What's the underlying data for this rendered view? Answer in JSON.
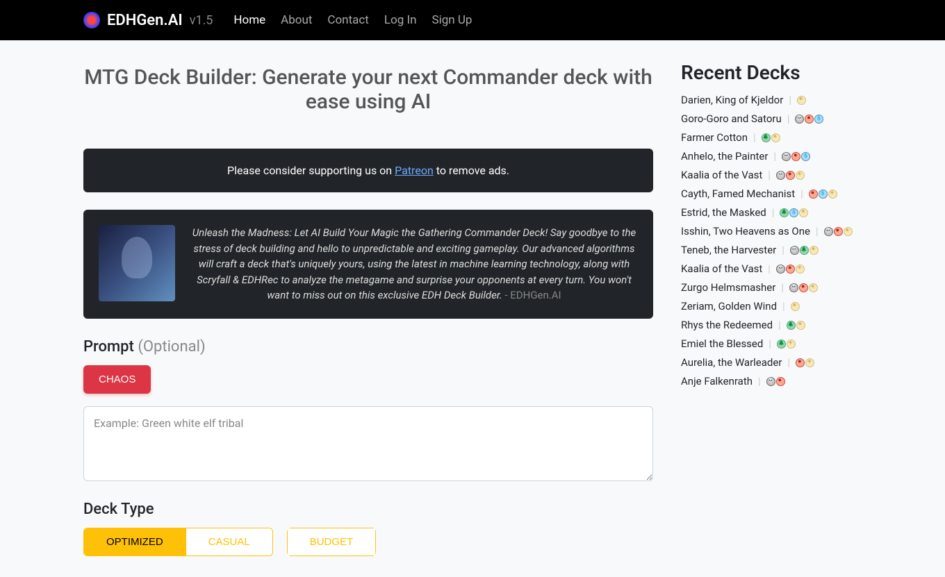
{
  "header": {
    "brand_name": "EDHGen.AI",
    "brand_version": "v1.5",
    "nav": [
      "Home",
      "About",
      "Contact",
      "Log In",
      "Sign Up"
    ],
    "active_nav_index": 0
  },
  "main": {
    "page_title": "MTG Deck Builder: Generate your next Commander deck with ease using AI",
    "support_banner": {
      "prefix": "Please consider supporting us on ",
      "link_text": "Patreon",
      "suffix": " to remove ads."
    },
    "promo": {
      "text": "Unleash the Madness: Let AI Build Your Magic the Gathering Commander Deck! Say goodbye to the stress of deck building and hello to unpredictable and exciting gameplay. Our advanced algorithms will craft a deck that's uniquely yours, using the latest in machine learning technology, along with Scryfall & EDHRec to analyze the metagame and surprise your opponents at every turn. You won't want to miss out on this exclusive EDH Deck Builder.",
      "attribution": " - EDHGen.AI"
    },
    "prompt": {
      "label": "Prompt ",
      "optional": "(Optional)",
      "chaos_button": "CHAOS",
      "placeholder": "Example: Green white elf tribal",
      "value": ""
    },
    "deck_type": {
      "label": "Deck Type",
      "options": [
        "OPTIMIZED",
        "CASUAL",
        "BUDGET"
      ],
      "selected_index": 0
    }
  },
  "sidebar": {
    "heading": "Recent Decks",
    "decks": [
      {
        "name": "Darien, King of Kjeldor",
        "colors": [
          "w"
        ]
      },
      {
        "name": "Goro-Goro and Satoru",
        "colors": [
          "b",
          "r",
          "u"
        ]
      },
      {
        "name": "Farmer Cotton",
        "colors": [
          "g",
          "w"
        ]
      },
      {
        "name": "Anhelo, the Painter",
        "colors": [
          "b",
          "r",
          "u"
        ]
      },
      {
        "name": "Kaalia of the Vast",
        "colors": [
          "b",
          "r",
          "w"
        ]
      },
      {
        "name": "Cayth, Famed Mechanist",
        "colors": [
          "r",
          "u",
          "w"
        ]
      },
      {
        "name": "Estrid, the Masked",
        "colors": [
          "g",
          "u",
          "w"
        ]
      },
      {
        "name": "Isshin, Two Heavens as One",
        "colors": [
          "b",
          "r",
          "w"
        ]
      },
      {
        "name": "Teneb, the Harvester",
        "colors": [
          "b",
          "g",
          "w"
        ]
      },
      {
        "name": "Kaalia of the Vast",
        "colors": [
          "b",
          "r",
          "w"
        ]
      },
      {
        "name": "Zurgo Helmsmasher",
        "colors": [
          "b",
          "r",
          "w"
        ]
      },
      {
        "name": "Zeriam, Golden Wind",
        "colors": [
          "w"
        ]
      },
      {
        "name": "Rhys the Redeemed",
        "colors": [
          "g",
          "w"
        ]
      },
      {
        "name": "Emiel the Blessed",
        "colors": [
          "g",
          "w"
        ]
      },
      {
        "name": "Aurelia, the Warleader",
        "colors": [
          "r",
          "w"
        ]
      },
      {
        "name": "Anje Falkenrath",
        "colors": [
          "b",
          "r"
        ]
      }
    ]
  }
}
